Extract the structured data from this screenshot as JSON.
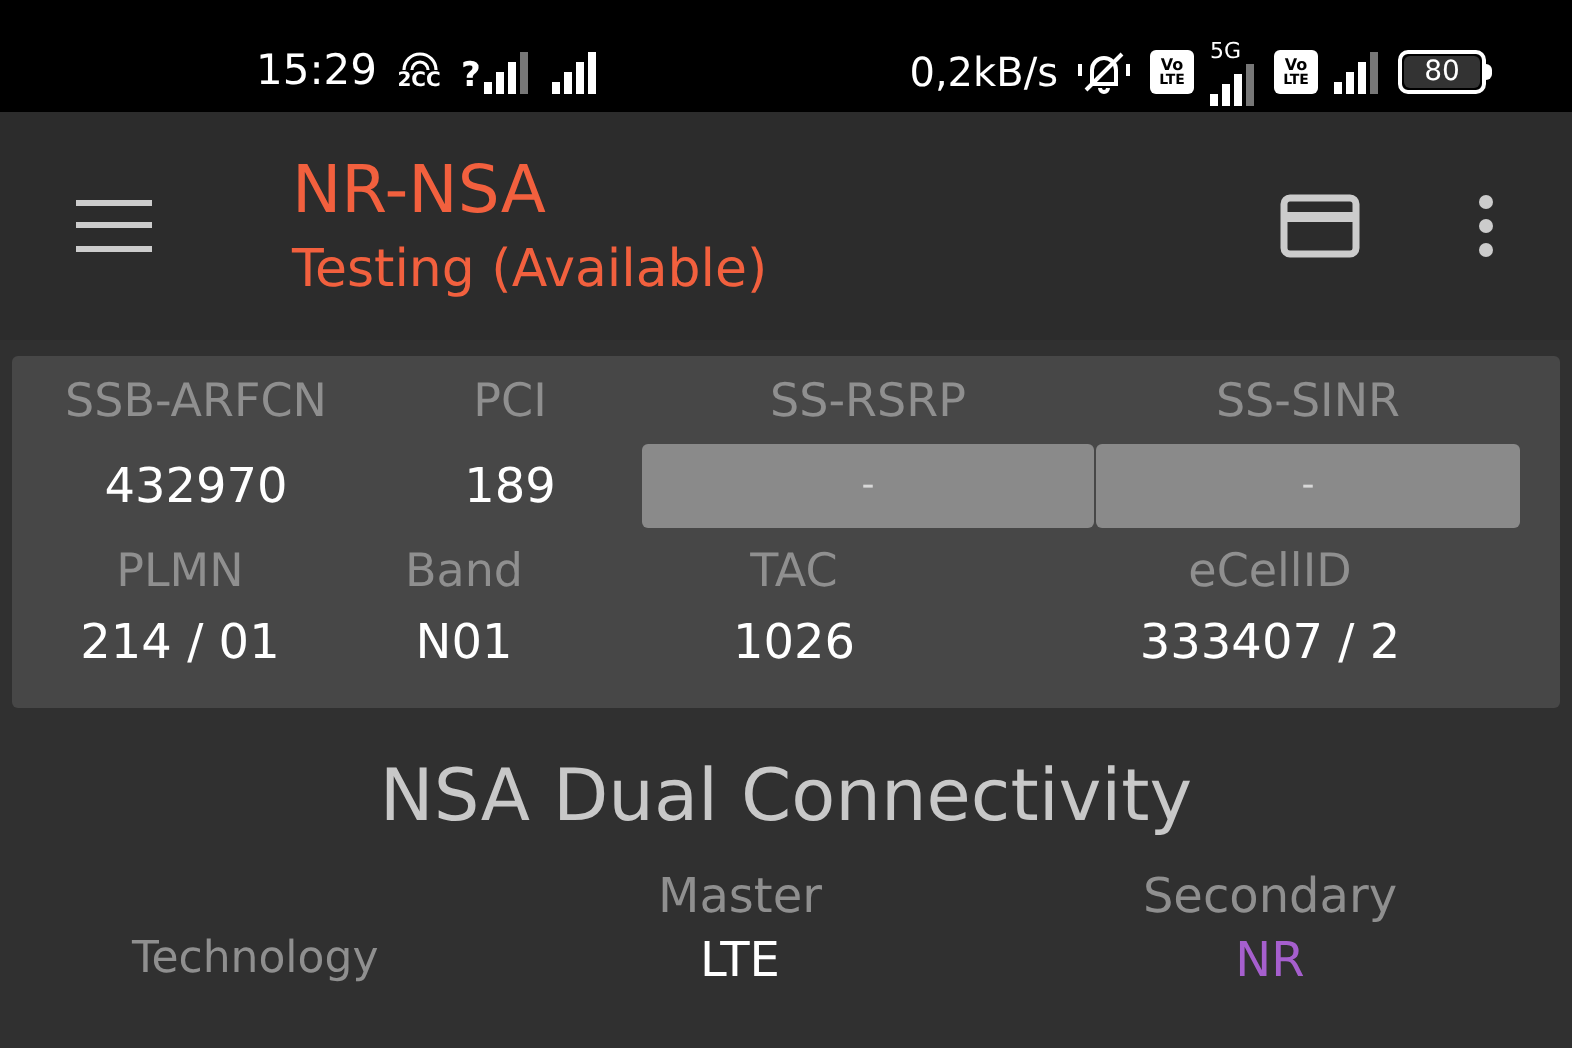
{
  "status_bar": {
    "time": "15:29",
    "hotspot_label": "2CC",
    "sim_unknown_mark": "?",
    "data_rate": "0,2kB/s",
    "network_type": "5G",
    "battery": "80",
    "volte_badges": [
      {
        "top": "Vo",
        "bottom": "LTE"
      },
      {
        "top": "Vo",
        "bottom": "LTE"
      }
    ]
  },
  "app_bar": {
    "title": "NR-NSA",
    "subtitle": "Testing (Available)"
  },
  "cell_info": {
    "row_1": [
      {
        "label": "SSB-ARFCN",
        "value": "432970",
        "kind": "text"
      },
      {
        "label": "PCI",
        "value": "189",
        "kind": "text"
      },
      {
        "label": "SS-RSRP",
        "value": "-",
        "kind": "box"
      },
      {
        "label": "SS-SINR",
        "value": "-",
        "kind": "box"
      }
    ],
    "row_2": [
      {
        "label": "PLMN",
        "value": "214 / 01"
      },
      {
        "label": "Band",
        "value": "N01"
      },
      {
        "label": "TAC",
        "value": "1026"
      },
      {
        "label": "eCellID",
        "value": "333407 / 2"
      }
    ]
  },
  "connectivity": {
    "title": "NSA Dual Connectivity",
    "columns": [
      "Master",
      "Secondary"
    ],
    "rows": [
      {
        "label": "Technology",
        "master": "LTE",
        "secondary": "NR"
      }
    ]
  }
}
